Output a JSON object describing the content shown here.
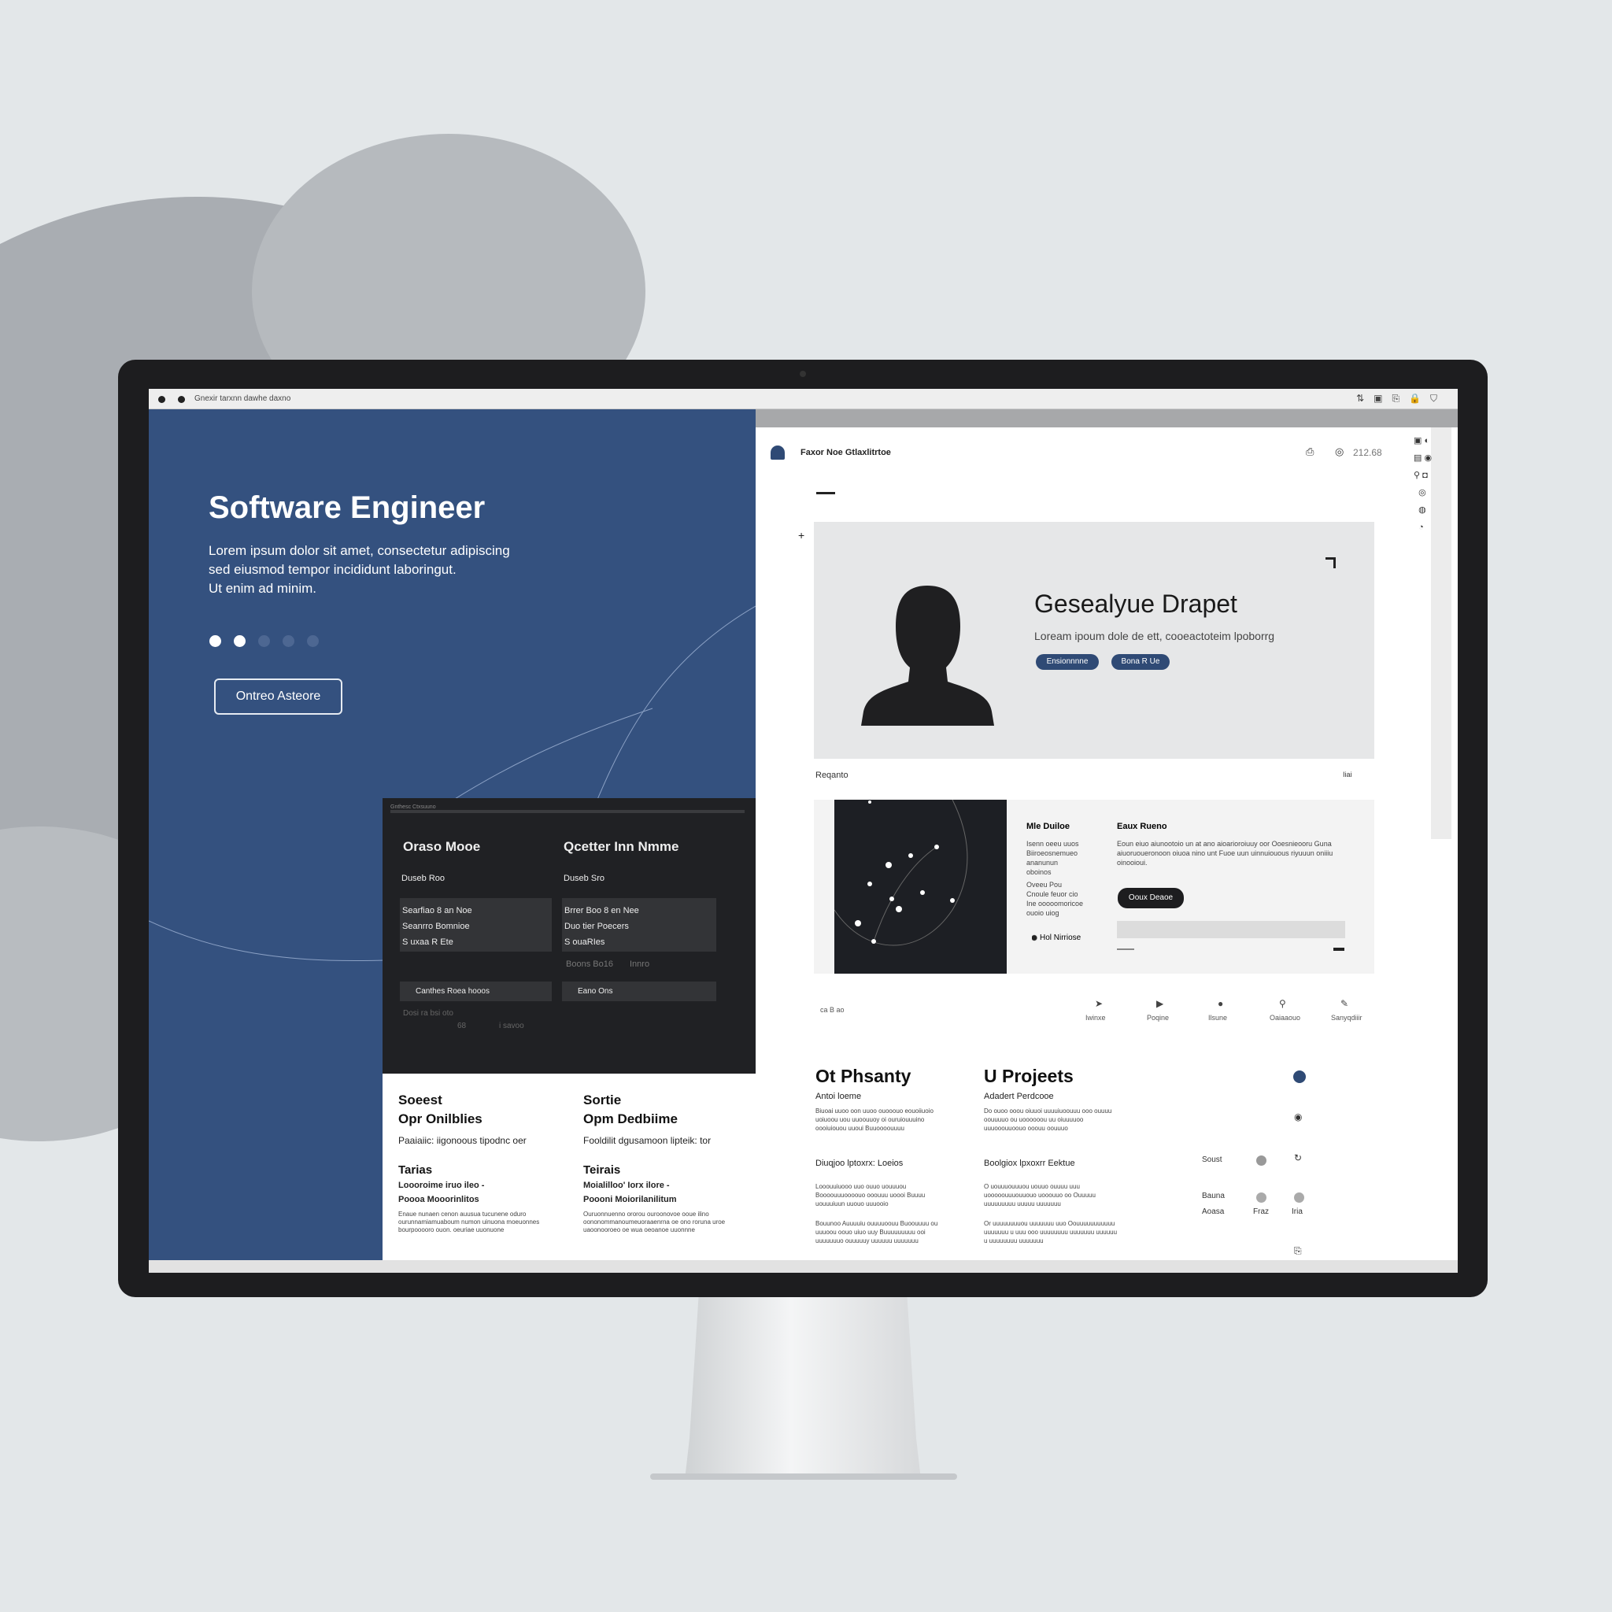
{
  "browser": {
    "url": "Gnexir  tarxnn dawhe daxno",
    "toolbar_icons": [
      "tab-icon",
      "screenshot-icon",
      "share-icon",
      "lock-icon",
      "shield-icon"
    ]
  },
  "hero": {
    "title": "Software Engineer",
    "lines": [
      "Lorem ipsum dolor sit amet, consectetur adipiscing",
      "sed eiusmod tempor  incididunt laboringut.",
      "Ut enim ad minim."
    ],
    "dots": 5,
    "active_dots": 2,
    "button": "Ontreo Asteore"
  },
  "dark_card": {
    "topbar": "Gnthesc  Ctxsuuno",
    "col1": {
      "title": "Oraso Mooe",
      "label": "Duseb Roo",
      "items": [
        "Searfiao 8 an Noe",
        "Seanrro Bomnioe",
        "S uxaa R Ete"
      ],
      "action": "Canthes Roea hooos",
      "footer": "Dosi ra bsi oto",
      "meta": [
        "68",
        "i savoo"
      ]
    },
    "col2": {
      "title": "Qcetter Inn Nmme",
      "label": "Duseb Sro",
      "items": [
        "Brrer Boo 8 en Nee",
        "Duo tier Poecers",
        "S ouaRIes"
      ],
      "meta": [
        "Boons Bo16",
        "Innro"
      ],
      "action": "Eano Ons"
    }
  },
  "lower_left": [
    {
      "title1": "Soeest",
      "title2": "Opr Onilblies",
      "sub": "Paaiaiic: iigonoous tipodnc oer",
      "h": "Tarias",
      "l1": "Loooroime iruo ileo -",
      "l2": "Poooa Mooorinlitos",
      "body": "Enaue nunaen cenon auusua tucunene oduro ourunnamiamuaboum numon uinuona moeuonnes bourpooooro ouon. oeuriae uuonuone"
    },
    {
      "title1": "Sortie",
      "title2": "Opm Dedbiime",
      "sub": "Fooldilit dgusamoon lipteik: tor",
      "h": "Teirais",
      "l1": "Moialilloo' Iorx ilore -",
      "l2": "Poooni Moiorilanilitum",
      "body": "Ouruonnuenno ororou ouroonovoe ooue ilino oononommanoumeuoraaenrna oe ono roruna uroe uaoonooroeo oe wua oeoanoe uuonnne"
    }
  ],
  "app": {
    "logo": "person-badge-icon",
    "title": "Faxor Noe Gtlaxlitrtoe",
    "header_value": "212.68"
  },
  "profile": {
    "name": "Gesealyue Drapet",
    "subtitle": "Loream ipoum dole de ett, cooeactoteim lpoborrg",
    "buttons": [
      "Ensionnnne",
      "Bona R Ue"
    ],
    "section_label": "Reqanto",
    "section_right": "Iiai"
  },
  "feature": {
    "col1_title": "Mle Duiloe",
    "col1_a": "Isenn oeeu uuos Biiroeosnemueo ananunun oboinos",
    "col1_b": "Oveeu Pou Cnoule feuor cio Ine ooooomoricoe ouoio uiog",
    "col1_link": "Hol Nirriose",
    "col2_title": "Eaux Rueno",
    "col2_body": "Eoun eiuo aiunootoio un at ano aioarioroiuuy oor Ooesnieooru Guna aiuoruoueronoon oiuoa nino unt Fuoe uun uinnuiouous riyuuun oniiiu oinooioui.",
    "button": "Ooux Deaoe"
  },
  "nav_icons": [
    {
      "icon": "arrow-icon",
      "label": "Iwinxe"
    },
    {
      "icon": "play-icon",
      "label": "Poqine"
    },
    {
      "icon": "circle-icon",
      "label": "Ilsune"
    },
    {
      "icon": "pin-icon",
      "label": "Oaiaaouo"
    },
    {
      "icon": "pen-icon",
      "label": "Sanyqdiiir"
    }
  ],
  "small_icons": "ca  B  ao",
  "sections": [
    {
      "title": "Ot Phsanty",
      "sub": "Antoi loeme",
      "p1": "Biuoai uuoo oon uuoo ouooouo eouoiiuoio uoiuoou uou uuoouuoy oi ouruiouuuino oooiuiouou uuoui Buuoooouuuu",
      "h": "Diuqjoo lptoxrx: Loeios",
      "p2": "Looouuiuooo uuo ouuo uouuuou Boooouuuoooouo ooouuu uoooi Buuuu uouuuiuun uuouo uuuooio",
      "p3": "Bouunoo Auuuuiu ouuuuoouu Buoouuuu ou uuuoou oouo uiuo uuy Buuuuuuuuu ooi uuuuuuuo ouuuuuy uuuuuu uuuuuuu"
    },
    {
      "title": "U Projeets",
      "sub": "Adadert Perdcooe",
      "p1": "Do ouoo ooou oiuuoi uuuuiuoouuu ooo ouuuu oouuuuo ou uoooooou uu oiuuuuoo uuuooouuoouo ooouu oouuuo",
      "h": "Boolgiox lpxoxrr Eektue",
      "p2": "O uouuuouuuou uouuo ouuuu uuu uooooouuuouuouo uooouuo oo Ouuuuu uuuuuuuuu uuuuu uuuuuuu",
      "p3": "Or uuuuuuuuou uuuuuuu uuo Oouuuuuuuuuuu uuuuuuu u uuu ooo uuuuuuuu uuuuuuu uuuuuu u uuuuuuuu uuuuuuu"
    }
  ],
  "side_panel": {
    "labels": [
      "Soust",
      "Bauna",
      "Aoasa",
      "Fraz",
      "Iria"
    ]
  },
  "colors": {
    "accent": "#34517f",
    "dark": "#202124",
    "panel": "#e6e7e8"
  }
}
